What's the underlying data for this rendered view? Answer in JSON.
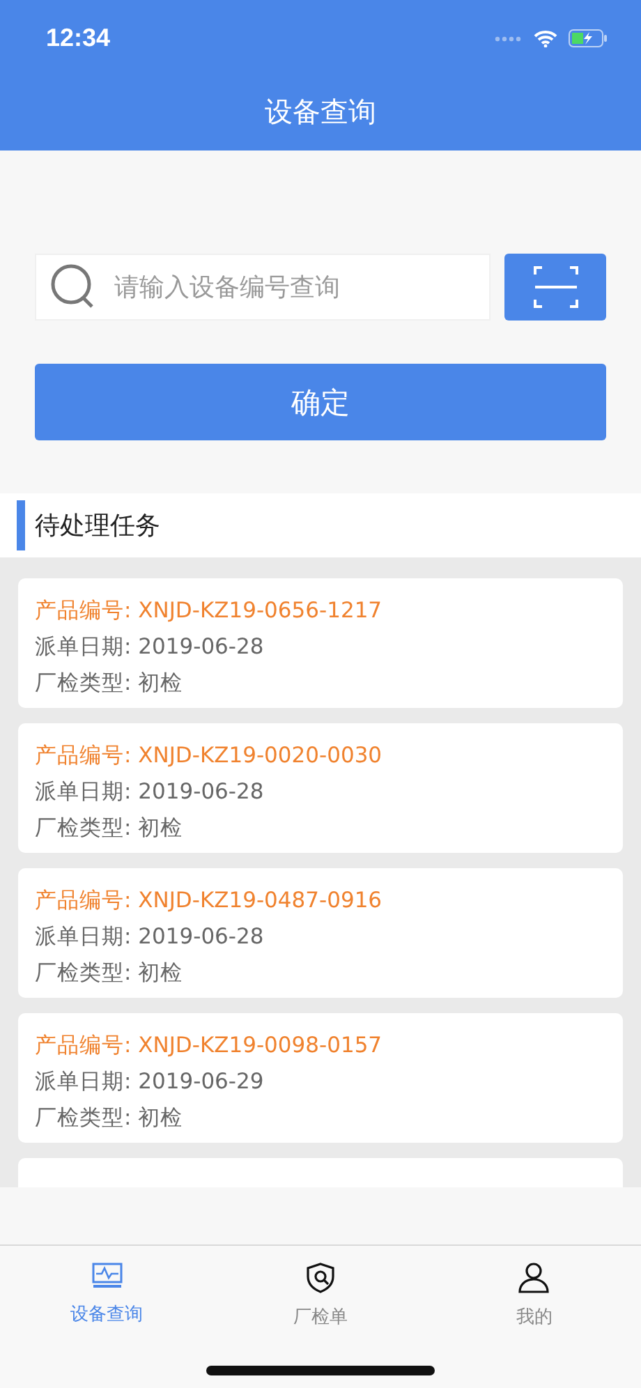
{
  "status_bar": {
    "time": "12:34"
  },
  "nav_bar": {
    "title": "设备查询"
  },
  "search": {
    "placeholder": "请输入设备编号查询"
  },
  "confirm_button": "确定",
  "section": {
    "title": "待处理任务"
  },
  "tasks": [
    {
      "product_no": "产品编号: XNJD-KZ19-0656-1217",
      "dispatch_date": "派单日期: 2019-06-28",
      "inspection_type": "厂检类型: 初检"
    },
    {
      "product_no": "产品编号: XNJD-KZ19-0020-0030",
      "dispatch_date": "派单日期: 2019-06-28",
      "inspection_type": "厂检类型: 初检"
    },
    {
      "product_no": "产品编号: XNJD-KZ19-0487-0916",
      "dispatch_date": "派单日期: 2019-06-28",
      "inspection_type": "厂检类型: 初检"
    },
    {
      "product_no": "产品编号: XNJD-KZ19-0098-0157",
      "dispatch_date": "派单日期: 2019-06-29",
      "inspection_type": "厂检类型: 初检"
    }
  ],
  "more_tasks_below": true,
  "tab_bar": [
    {
      "kind": "device",
      "label": "设备查询",
      "selected": true
    },
    {
      "kind": "inspection",
      "label": "厂检单",
      "selected": false
    },
    {
      "kind": "profile",
      "label": "我的",
      "selected": false
    }
  ]
}
